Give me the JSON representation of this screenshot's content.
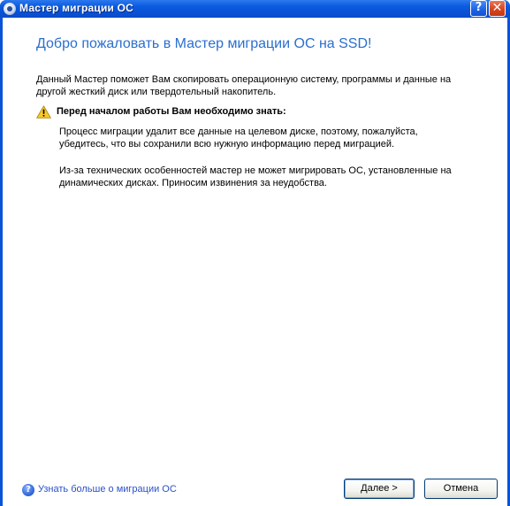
{
  "window": {
    "title": "Мастер миграции ОС",
    "help_button": "?",
    "close_button": "✕"
  },
  "main": {
    "heading": "Добро пожаловать в Мастер миграции ОС на SSD!",
    "intro": "Данный Мастер поможет Вам скопировать операционную систему, программы и данные на другой жесткий диск или твердотельный накопитель.",
    "warning_title": "Перед началом работы Вам необходимо знать:",
    "paragraphs": [
      "Процесс миграции удалит все данные на целевом диске, поэтому, пожалуйста, убедитесь, что вы сохранили всю нужную информацию перед миграцией.",
      "Из-за технических особенностей мастер не может мигрировать ОС, установленные на динамических дисках. Приносим извинения за неудобства."
    ]
  },
  "footer": {
    "help_link": "Узнать больше о миграции ОС",
    "next_button": "Далее >",
    "cancel_button": "Отмена"
  },
  "icons": {
    "app": "app-icon",
    "warning": "warning-icon",
    "help": "help-icon"
  },
  "colors": {
    "titlebar": "#0a53d8",
    "heading": "#2a6fcf",
    "link": "#2a50c8",
    "close": "#d6451f"
  }
}
